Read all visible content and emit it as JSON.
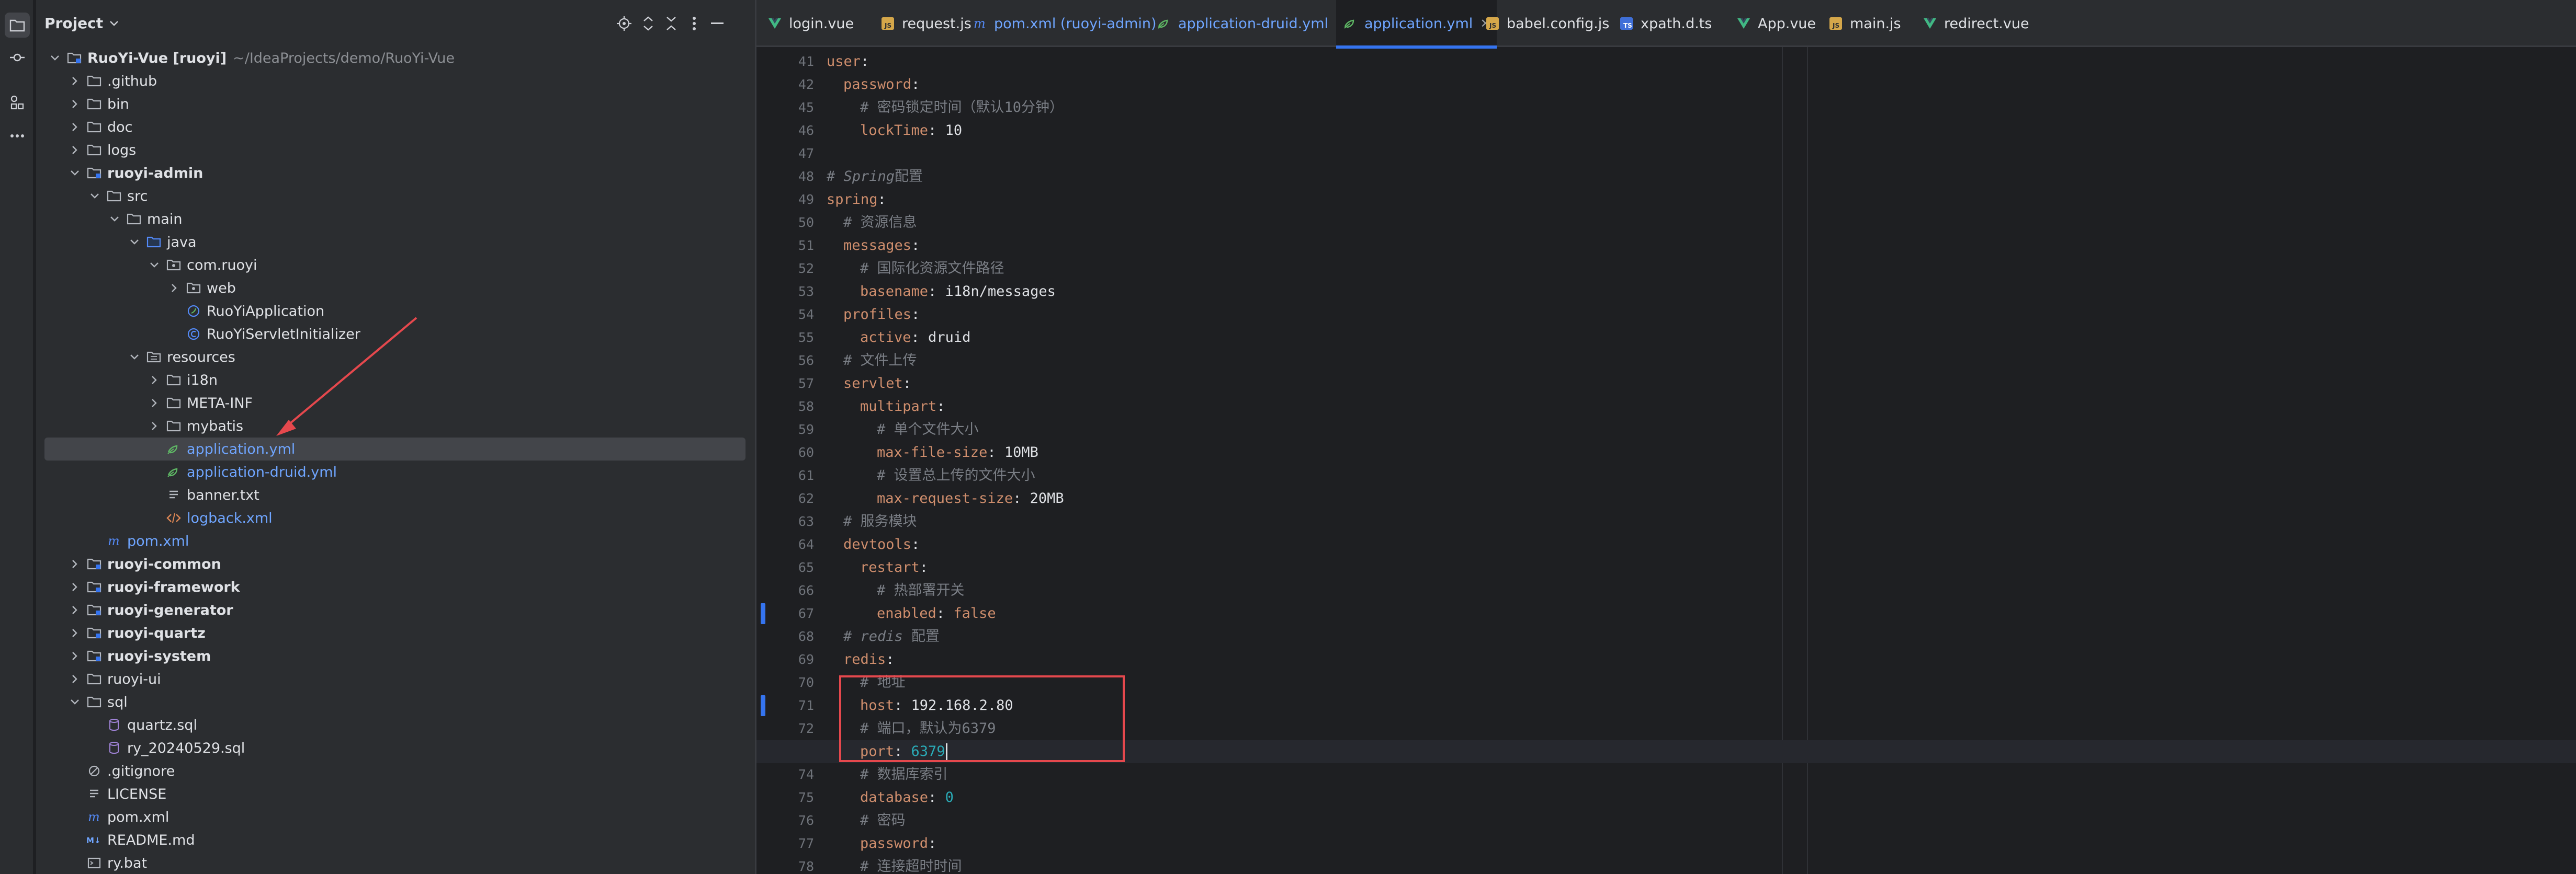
{
  "project_panel": {
    "title": "Project",
    "tree": [
      {
        "label": "RuoYi-Vue [ruoyi]",
        "sub": "~/IdeaProjects/demo/RuoYi-Vue",
        "depth": 0,
        "state": "open",
        "icon": "module-folder-icon",
        "bold": true
      },
      {
        "label": ".github",
        "depth": 1,
        "state": "closed",
        "icon": "folder-icon"
      },
      {
        "label": "bin",
        "depth": 1,
        "state": "closed",
        "icon": "folder-icon"
      },
      {
        "label": "doc",
        "depth": 1,
        "state": "closed",
        "icon": "folder-icon"
      },
      {
        "label": "logs",
        "depth": 1,
        "state": "closed",
        "icon": "folder-icon"
      },
      {
        "label": "ruoyi-admin",
        "depth": 1,
        "state": "open",
        "icon": "module-folder-icon",
        "bold": true
      },
      {
        "label": "src",
        "depth": 2,
        "state": "open",
        "icon": "folder-icon"
      },
      {
        "label": "main",
        "depth": 3,
        "state": "open",
        "icon": "folder-icon"
      },
      {
        "label": "java",
        "depth": 4,
        "state": "open",
        "icon": "source-folder-icon"
      },
      {
        "label": "com.ruoyi",
        "depth": 5,
        "state": "open",
        "icon": "package-icon"
      },
      {
        "label": "web",
        "depth": 6,
        "state": "closed",
        "icon": "package-icon"
      },
      {
        "label": "RuoYiApplication",
        "depth": 6,
        "state": "none",
        "icon": "spring-class-icon"
      },
      {
        "label": "RuoYiServletInitializer",
        "depth": 6,
        "state": "none",
        "icon": "class-icon"
      },
      {
        "label": "resources",
        "depth": 4,
        "state": "open",
        "icon": "resources-folder-icon"
      },
      {
        "label": "i18n",
        "depth": 5,
        "state": "closed",
        "icon": "folder-icon"
      },
      {
        "label": "META-INF",
        "depth": 5,
        "state": "closed",
        "icon": "folder-icon"
      },
      {
        "label": "mybatis",
        "depth": 5,
        "state": "closed",
        "icon": "folder-icon"
      },
      {
        "label": "application.yml",
        "depth": 5,
        "state": "none",
        "icon": "spring-yaml-icon",
        "color": "blue",
        "selected": true
      },
      {
        "label": "application-druid.yml",
        "depth": 5,
        "state": "none",
        "icon": "spring-yaml-icon",
        "color": "blue"
      },
      {
        "label": "banner.txt",
        "depth": 5,
        "state": "none",
        "icon": "text-file-icon"
      },
      {
        "label": "logback.xml",
        "depth": 5,
        "state": "none",
        "icon": "xml-file-icon",
        "color": "blue"
      },
      {
        "label": "pom.xml",
        "depth": 2,
        "state": "none",
        "icon": "maven-icon",
        "color": "blue"
      },
      {
        "label": "ruoyi-common",
        "depth": 1,
        "state": "closed",
        "icon": "module-folder-icon",
        "bold": true
      },
      {
        "label": "ruoyi-framework",
        "depth": 1,
        "state": "closed",
        "icon": "module-folder-icon",
        "bold": true
      },
      {
        "label": "ruoyi-generator",
        "depth": 1,
        "state": "closed",
        "icon": "module-folder-icon",
        "bold": true
      },
      {
        "label": "ruoyi-quartz",
        "depth": 1,
        "state": "closed",
        "icon": "module-folder-icon",
        "bold": true
      },
      {
        "label": "ruoyi-system",
        "depth": 1,
        "state": "closed",
        "icon": "module-folder-icon",
        "bold": true
      },
      {
        "label": "ruoyi-ui",
        "depth": 1,
        "state": "closed",
        "icon": "folder-icon"
      },
      {
        "label": "sql",
        "depth": 1,
        "state": "open",
        "icon": "folder-icon"
      },
      {
        "label": "quartz.sql",
        "depth": 2,
        "state": "none",
        "icon": "sql-file-icon"
      },
      {
        "label": "ry_20240529.sql",
        "depth": 2,
        "state": "none",
        "icon": "sql-file-icon"
      },
      {
        "label": ".gitignore",
        "depth": 1,
        "state": "none",
        "icon": "ignore-file-icon"
      },
      {
        "label": "LICENSE",
        "depth": 1,
        "state": "none",
        "icon": "text-file-icon"
      },
      {
        "label": "pom.xml",
        "depth": 1,
        "state": "none",
        "icon": "maven-icon"
      },
      {
        "label": "README.md",
        "depth": 1,
        "state": "none",
        "icon": "markdown-icon"
      },
      {
        "label": "ry.bat",
        "depth": 1,
        "state": "none",
        "icon": "bat-file-icon"
      }
    ]
  },
  "tabs": [
    {
      "label": "login.vue",
      "icon": "vue-icon"
    },
    {
      "label": "request.js",
      "icon": "js-icon"
    },
    {
      "label": "pom.xml (ruoyi-admin)",
      "icon": "maven-icon",
      "color": "blue"
    },
    {
      "label": "application-druid.yml",
      "icon": "spring-yaml-icon",
      "color": "blue"
    },
    {
      "label": "application.yml",
      "icon": "spring-yaml-icon",
      "color": "blue",
      "active": true
    },
    {
      "label": "babel.config.js",
      "icon": "js-icon"
    },
    {
      "label": "xpath.d.ts",
      "icon": "ts-icon"
    },
    {
      "label": "App.vue",
      "icon": "vue-icon"
    },
    {
      "label": "main.js",
      "icon": "js-icon"
    },
    {
      "label": "redirect.vue",
      "icon": "vue-icon"
    }
  ],
  "editor": {
    "lines": [
      {
        "n": "41",
        "indent": 0,
        "parts": [
          [
            "k",
            "user"
          ],
          [
            "v",
            ":"
          ]
        ]
      },
      {
        "n": "42",
        "indent": 1,
        "parts": [
          [
            "k",
            "password"
          ],
          [
            "v",
            ":"
          ]
        ]
      },
      {
        "n": "45",
        "indent": 2,
        "parts": [
          [
            "cz",
            "# 密码锁定时间（默认10分钟）"
          ]
        ]
      },
      {
        "n": "46",
        "indent": 2,
        "parts": [
          [
            "k",
            "lockTime"
          ],
          [
            "v",
            ": 10"
          ]
        ]
      },
      {
        "n": "47",
        "indent": 0,
        "parts": []
      },
      {
        "n": "48",
        "indent": 0,
        "parts": [
          [
            "c",
            "# Spring"
          ],
          [
            "cz",
            "配置"
          ]
        ]
      },
      {
        "n": "49",
        "indent": 0,
        "parts": [
          [
            "k",
            "spring"
          ],
          [
            "v",
            ":"
          ]
        ]
      },
      {
        "n": "50",
        "indent": 1,
        "parts": [
          [
            "cz",
            "# 资源信息"
          ]
        ]
      },
      {
        "n": "51",
        "indent": 1,
        "parts": [
          [
            "k",
            "messages"
          ],
          [
            "v",
            ":"
          ]
        ]
      },
      {
        "n": "52",
        "indent": 2,
        "parts": [
          [
            "cz",
            "# 国际化资源文件路径"
          ]
        ]
      },
      {
        "n": "53",
        "indent": 2,
        "parts": [
          [
            "k",
            "basename"
          ],
          [
            "v",
            ": i18n/messages"
          ]
        ]
      },
      {
        "n": "54",
        "indent": 1,
        "parts": [
          [
            "k",
            "profiles"
          ],
          [
            "v",
            ":"
          ]
        ]
      },
      {
        "n": "55",
        "indent": 2,
        "parts": [
          [
            "k",
            "active"
          ],
          [
            "v",
            ": druid"
          ]
        ]
      },
      {
        "n": "56",
        "indent": 1,
        "parts": [
          [
            "cz",
            "# 文件上传"
          ]
        ]
      },
      {
        "n": "57",
        "indent": 1,
        "parts": [
          [
            "k",
            "servlet"
          ],
          [
            "v",
            ":"
          ]
        ]
      },
      {
        "n": "58",
        "indent": 2,
        "parts": [
          [
            "k",
            "multipart"
          ],
          [
            "v",
            ":"
          ]
        ]
      },
      {
        "n": "59",
        "indent": 3,
        "parts": [
          [
            "cz",
            "# 单个文件大小"
          ]
        ]
      },
      {
        "n": "60",
        "indent": 3,
        "parts": [
          [
            "k",
            "max-file-size"
          ],
          [
            "v",
            ": 10MB"
          ]
        ]
      },
      {
        "n": "61",
        "indent": 3,
        "parts": [
          [
            "cz",
            "# 设置总上传的文件大小"
          ]
        ]
      },
      {
        "n": "62",
        "indent": 3,
        "parts": [
          [
            "k",
            "max-request-size"
          ],
          [
            "v",
            ": 20MB"
          ]
        ]
      },
      {
        "n": "63",
        "indent": 1,
        "parts": [
          [
            "cz",
            "# 服务模块"
          ]
        ]
      },
      {
        "n": "64",
        "indent": 1,
        "parts": [
          [
            "k",
            "devtools"
          ],
          [
            "v",
            ":"
          ]
        ]
      },
      {
        "n": "65",
        "indent": 2,
        "parts": [
          [
            "k",
            "restart"
          ],
          [
            "v",
            ":"
          ]
        ]
      },
      {
        "n": "66",
        "indent": 3,
        "parts": [
          [
            "cz",
            "# 热部署开关"
          ]
        ]
      },
      {
        "n": "67",
        "indent": 3,
        "parts": [
          [
            "k",
            "enabled"
          ],
          [
            "v",
            ": "
          ],
          [
            "k",
            "false"
          ]
        ]
      },
      {
        "n": "68",
        "indent": 1,
        "parts": [
          [
            "c",
            "# redis "
          ],
          [
            "cz",
            "配置"
          ]
        ]
      },
      {
        "n": "69",
        "indent": 1,
        "parts": [
          [
            "k",
            "redis"
          ],
          [
            "v",
            ":"
          ]
        ]
      },
      {
        "n": "70",
        "indent": 2,
        "parts": [
          [
            "cz",
            "# 地址"
          ]
        ]
      },
      {
        "n": "71",
        "indent": 2,
        "parts": [
          [
            "k",
            "host"
          ],
          [
            "v",
            ": 192.168.2.80"
          ]
        ]
      },
      {
        "n": "72",
        "indent": 2,
        "parts": [
          [
            "cz",
            "# 端口，默认为6379"
          ]
        ]
      },
      {
        "n": "73",
        "indent": 2,
        "parts": [
          [
            "k",
            "port"
          ],
          [
            "v",
            ": "
          ],
          [
            "n",
            "6379"
          ]
        ],
        "current": true
      },
      {
        "n": "74",
        "indent": 2,
        "parts": [
          [
            "cz",
            "# 数据库索引"
          ]
        ]
      },
      {
        "n": "75",
        "indent": 2,
        "parts": [
          [
            "k",
            "database"
          ],
          [
            "v",
            ": "
          ],
          [
            "n",
            "0"
          ]
        ]
      },
      {
        "n": "76",
        "indent": 2,
        "parts": [
          [
            "cz",
            "# 密码"
          ]
        ]
      },
      {
        "n": "77",
        "indent": 2,
        "parts": [
          [
            "k",
            "password"
          ],
          [
            "v",
            ":"
          ]
        ]
      },
      {
        "n": "78",
        "indent": 2,
        "parts": [
          [
            "cz",
            "# 连接超时时间"
          ]
        ]
      }
    ],
    "changed_lines": [
      "67",
      "71"
    ]
  },
  "colors": {
    "accent": "#3574f0",
    "annotation_red": "#e5484d",
    "keyword": "#cf8e6d",
    "number": "#2aacb8",
    "comment": "#7a7e85"
  }
}
